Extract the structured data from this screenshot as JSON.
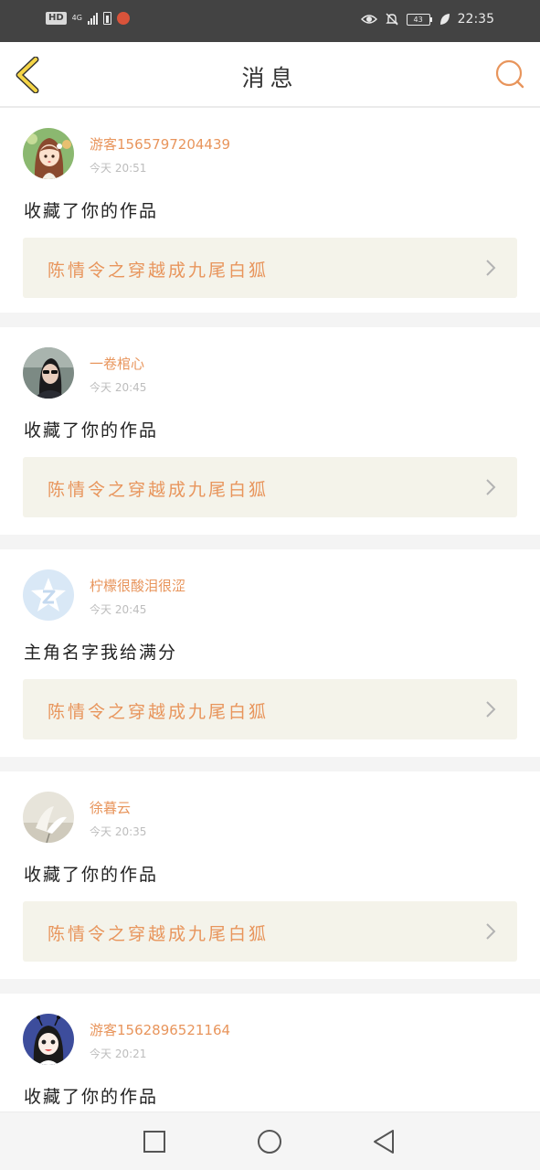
{
  "status_bar": {
    "hd": "HD",
    "network": "4G",
    "network_sub": "46",
    "battery": "43",
    "time": "22:35",
    "icons": [
      "hd-badge",
      "signal-icon",
      "battery-saver-icon",
      "app-notification-icon",
      "eye-comfort-icon",
      "mute-icon",
      "battery-icon",
      "leaf-icon"
    ]
  },
  "header": {
    "back_icon": "chevron-left-icon",
    "title": "消息",
    "search_icon": "search-icon"
  },
  "colors": {
    "accent": "#e8955c",
    "back_arrow": "#f5d547",
    "card_link_bg": "#f4f3ea",
    "separator": "#f4f4f4",
    "status_bar": "#434343"
  },
  "messages": [
    {
      "user": "游客1565797204439",
      "time": "今天 20:51",
      "action": "收藏了你的作品",
      "work": "陈情令之穿越成九尾白狐",
      "avatar": "cartoon-girl-avatar"
    },
    {
      "user": "一卷棺心",
      "time": "今天 20:45",
      "action": "收藏了你的作品",
      "work": "陈情令之穿越成九尾白狐",
      "avatar": "photo-avatar"
    },
    {
      "user": "柠檬很酸泪很涩",
      "time": "今天 20:45",
      "action": "主角名字我给满分",
      "work": "陈情令之穿越成九尾白狐",
      "avatar": "qq-default-avatar"
    },
    {
      "user": "徐暮云",
      "time": "今天 20:35",
      "action": "收藏了你的作品",
      "work": "陈情令之穿越成九尾白狐",
      "avatar": "flower-photo-avatar"
    },
    {
      "user": "游客1562896521164",
      "time": "今天 20:21",
      "action": "收藏了你的作品",
      "work": "",
      "avatar": "cartoon-bug-avatar"
    }
  ],
  "nav_bar": {
    "recents_icon": "square-icon",
    "home_icon": "circle-icon",
    "back_icon": "triangle-back-icon"
  }
}
